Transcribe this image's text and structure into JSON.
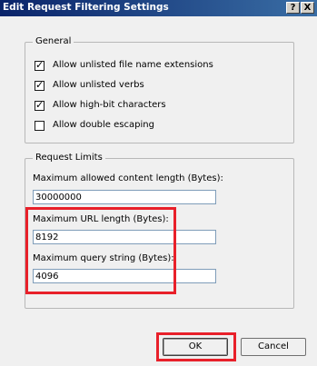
{
  "dialog": {
    "title": "Edit Request Filtering Settings",
    "help_glyph": "?",
    "close_glyph": "X"
  },
  "general": {
    "legend": "General",
    "options": [
      {
        "label": "Allow unlisted file name extensions",
        "checked": true
      },
      {
        "label": "Allow unlisted verbs",
        "checked": true
      },
      {
        "label": "Allow high-bit characters",
        "checked": true
      },
      {
        "label": "Allow double escaping",
        "checked": false
      }
    ]
  },
  "limits": {
    "legend": "Request Limits",
    "max_content_length_label": "Maximum allowed content length (Bytes):",
    "max_content_length_value": "30000000",
    "max_url_length_label": "Maximum URL length (Bytes):",
    "max_url_length_value": "8192",
    "max_query_string_label": "Maximum query string (Bytes):",
    "max_query_string_value": "4096"
  },
  "buttons": {
    "ok": "OK",
    "cancel": "Cancel"
  },
  "highlight_color": "#e8202a"
}
